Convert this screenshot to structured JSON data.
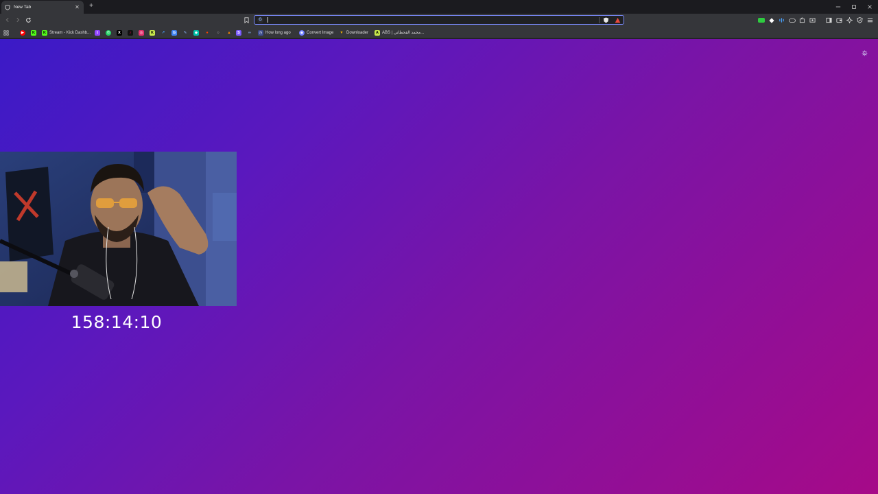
{
  "tabs": [
    {
      "title": "New Tab",
      "active": true
    }
  ],
  "window_controls": [
    "minimize",
    "restore",
    "close"
  ],
  "address_bar": {
    "value": "",
    "search_engine_icon": "google-g-icon"
  },
  "bookmarks": [
    {
      "label": "",
      "icon": "youtube-icon",
      "color": "#ff0000"
    },
    {
      "label": "",
      "icon": "kick-icon",
      "color": "#53fc18"
    },
    {
      "label": "Stream - Kick Dashb...",
      "icon": "kick-icon",
      "color": "#53fc18"
    },
    {
      "label": "",
      "icon": "twitch-icon",
      "color": "#9146ff"
    },
    {
      "label": "",
      "icon": "whatsapp-icon",
      "color": "#25d366"
    },
    {
      "label": "",
      "icon": "x-icon",
      "color": "#ffffff"
    },
    {
      "label": "",
      "icon": "tiktok-icon",
      "color": "#ff0050"
    },
    {
      "label": "",
      "icon": "instagram-icon",
      "color": "#e1306c"
    },
    {
      "label": "",
      "icon": "kick-icon",
      "color": "#53fc18"
    },
    {
      "label": "",
      "icon": "arrow-icon",
      "color": "#4aa3ff"
    },
    {
      "label": "",
      "icon": "translate-icon",
      "color": "#4285f4"
    },
    {
      "label": "",
      "icon": "pen-icon",
      "color": "#8ab4f8"
    },
    {
      "label": "",
      "icon": "chat-icon",
      "color": "#00c2a8"
    },
    {
      "label": "",
      "icon": "reddit-icon",
      "color": "#ff4500"
    },
    {
      "label": "",
      "icon": "github-icon",
      "color": "#cccccc"
    },
    {
      "label": "",
      "icon": "fire-icon",
      "color": "#ff8a00"
    },
    {
      "label": "",
      "icon": "streamer-icon",
      "color": "#a970ff"
    },
    {
      "label": "",
      "icon": "s-icon",
      "color": "#7c5cff"
    },
    {
      "label": "",
      "icon": "circle-icon",
      "color": "#888888"
    },
    {
      "label": "",
      "icon": "link-icon",
      "color": "#8ab4f8"
    },
    {
      "label": "How long ago",
      "icon": "clock-icon",
      "color": "#8ab4f8"
    },
    {
      "label": "Convert Image",
      "icon": "image-icon",
      "color": "#6d7cff"
    },
    {
      "label": "Downloader",
      "icon": "download-icon",
      "color": "#f4b400"
    },
    {
      "label": "ABS | محمد الفحطاني...",
      "icon": "abs-icon",
      "color": "#c7e84a"
    }
  ],
  "extensions": [
    {
      "icon": "ext-green-badge-icon",
      "color": "#2ecc40"
    },
    {
      "icon": "ext-diamond-icon",
      "color": "#ffffff"
    },
    {
      "icon": "ext-audio-icon",
      "color": "#4aa3ff"
    },
    {
      "icon": "ext-gamepad-icon",
      "color": "#cfcfcf"
    },
    {
      "icon": "ext-puzzle-icon",
      "color": "#cfcfcf"
    },
    {
      "icon": "ext-screenshot-icon",
      "color": "#cfcfcf"
    }
  ],
  "toolbar_right": [
    "sidebar-icon",
    "wallet-icon",
    "sparkle-icon",
    "vpn-shield-icon",
    "menu-icon"
  ],
  "page": {
    "background_start": "#3b1ac7",
    "background_end": "#a60a88",
    "timer_text": "158:14:10"
  }
}
